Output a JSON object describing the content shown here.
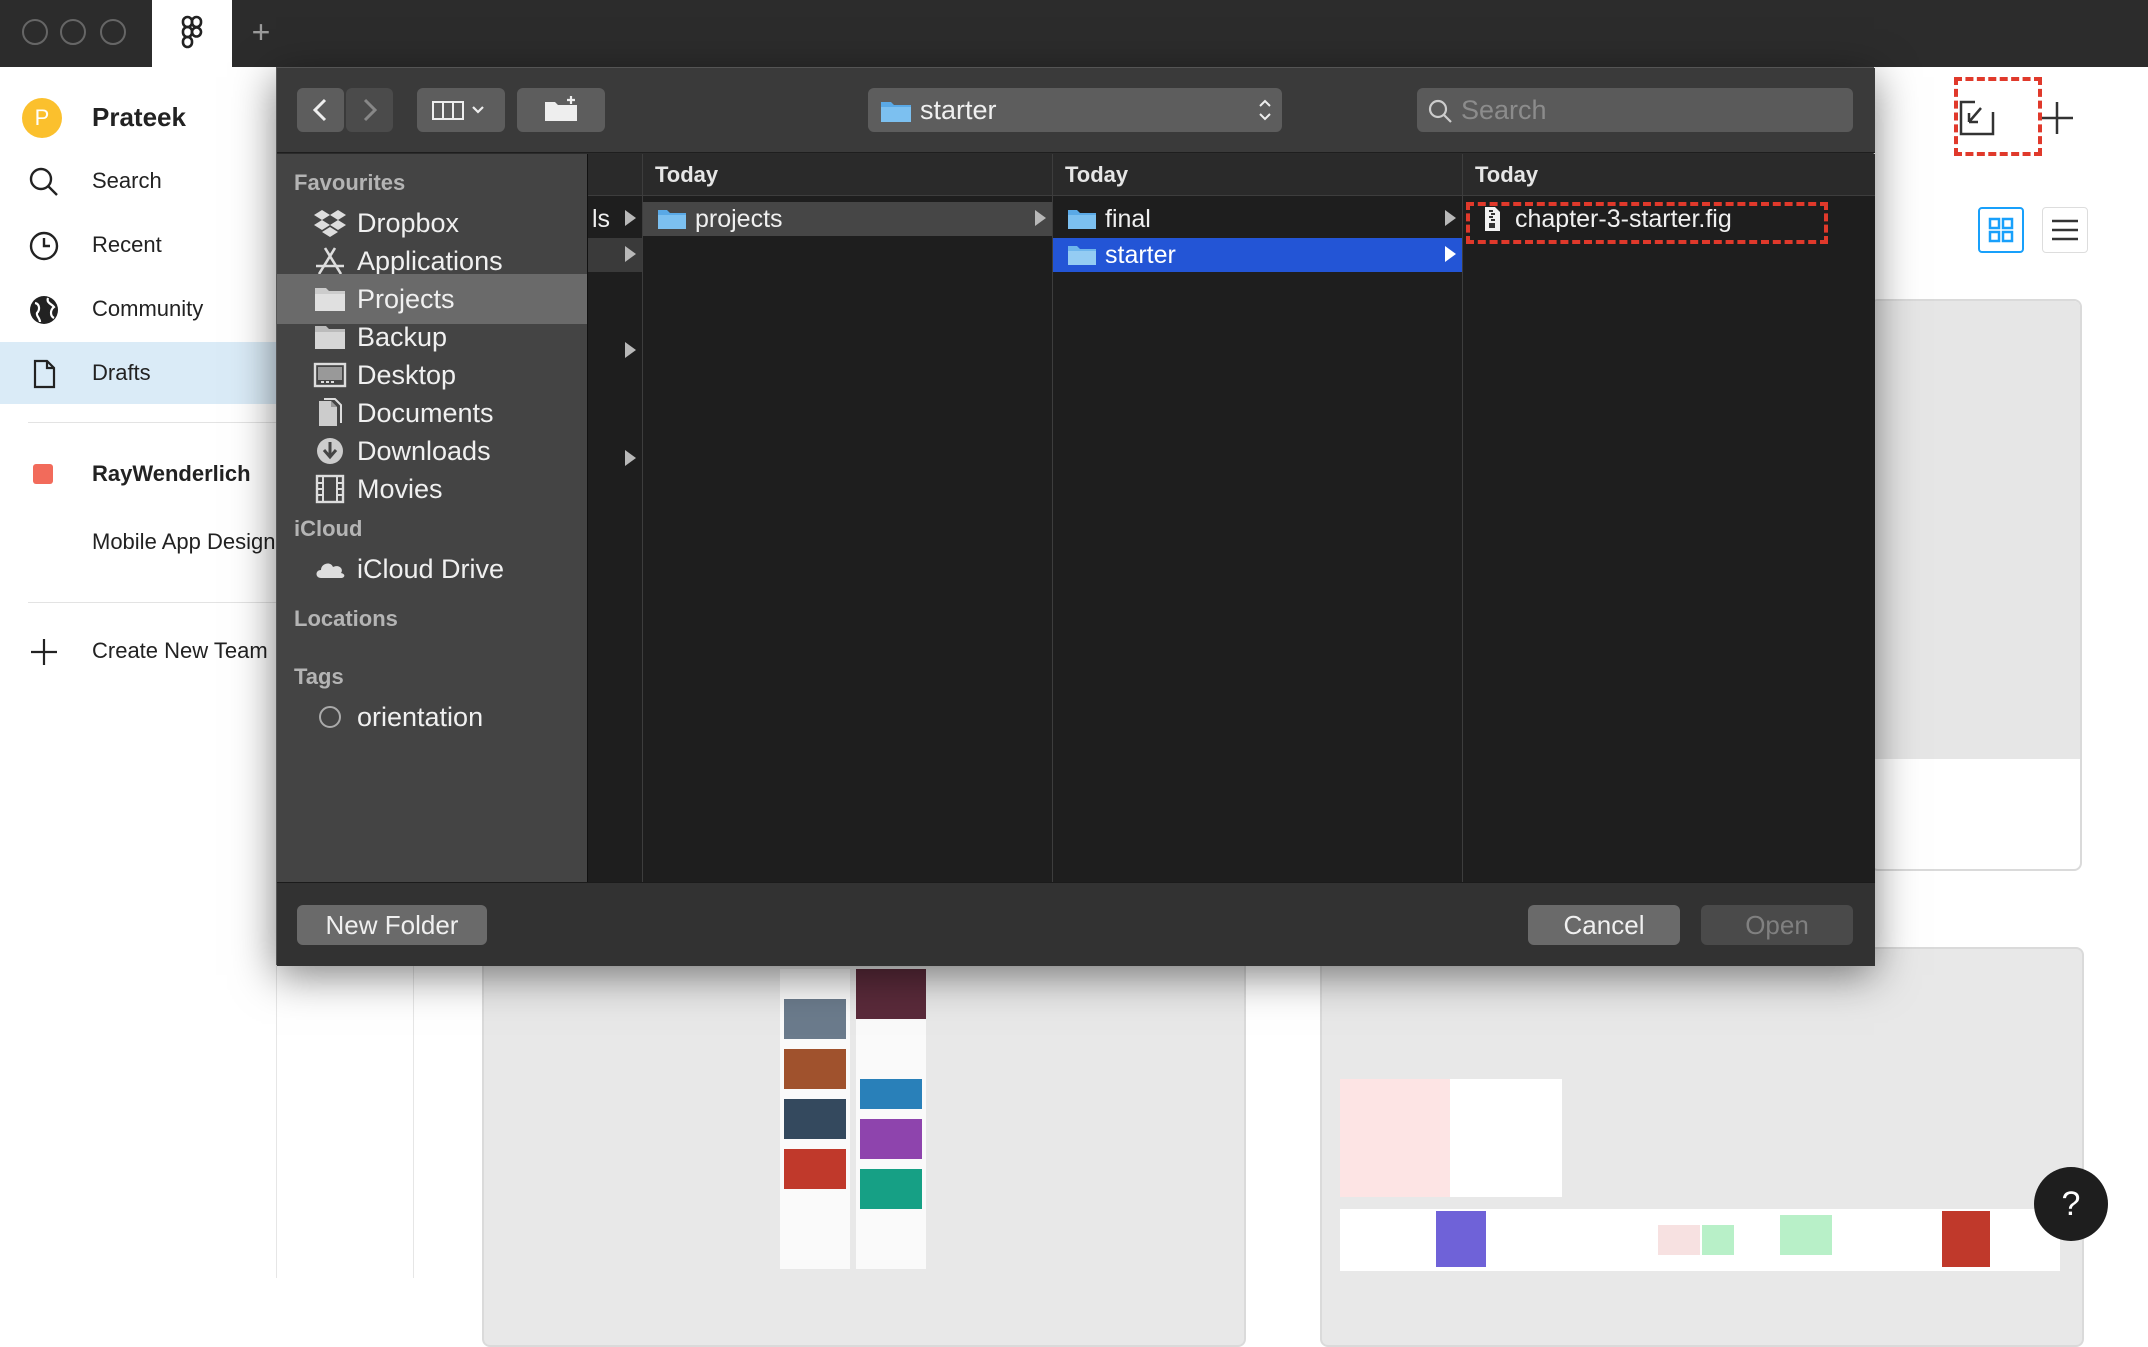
{
  "sidebar": {
    "user_initial": "P",
    "user_name": "Prateek",
    "items": [
      {
        "label": "Search"
      },
      {
        "label": "Recent"
      },
      {
        "label": "Community"
      },
      {
        "label": "Drafts"
      }
    ],
    "team_name": "RayWenderlich",
    "team_color": "#f26b5b",
    "project": "Mobile App Design",
    "create_team": "Create New Team"
  },
  "dialog": {
    "path": "starter",
    "search_placeholder": "Search",
    "sidebar": {
      "favourites_title": "Favourites",
      "favourites": [
        {
          "label": "Dropbox",
          "icon": "dropbox-icon"
        },
        {
          "label": "Applications",
          "icon": "applications-icon"
        },
        {
          "label": "Projects",
          "icon": "folder-icon"
        },
        {
          "label": "Backup",
          "icon": "folder-icon"
        },
        {
          "label": "Desktop",
          "icon": "desktop-icon"
        },
        {
          "label": "Documents",
          "icon": "documents-icon"
        },
        {
          "label": "Downloads",
          "icon": "downloads-icon"
        },
        {
          "label": "Movies",
          "icon": "movies-icon"
        }
      ],
      "icloud_title": "iCloud",
      "icloud": [
        {
          "label": "iCloud Drive",
          "icon": "cloud-icon"
        }
      ],
      "locations_title": "Locations",
      "tags_title": "Tags",
      "tags": [
        {
          "label": "orientation"
        }
      ]
    },
    "columns": [
      {
        "header": "",
        "rows": [
          {
            "label": "ls"
          }
        ]
      },
      {
        "header": "Today",
        "rows": [
          {
            "label": "projects"
          }
        ]
      },
      {
        "header": "Today",
        "rows": [
          {
            "label": "final"
          },
          {
            "label": "starter"
          }
        ]
      },
      {
        "header": "Today",
        "rows": [
          {
            "label": "chapter-3-starter.fig"
          }
        ]
      }
    ],
    "new_folder": "New Folder",
    "cancel": "Cancel",
    "open": "Open"
  },
  "help": "?",
  "colors": {
    "selection": "#2355d6",
    "highlight": "#e0392b",
    "folder": "#5aa9e6",
    "figma_blue": "#18a0fb"
  }
}
